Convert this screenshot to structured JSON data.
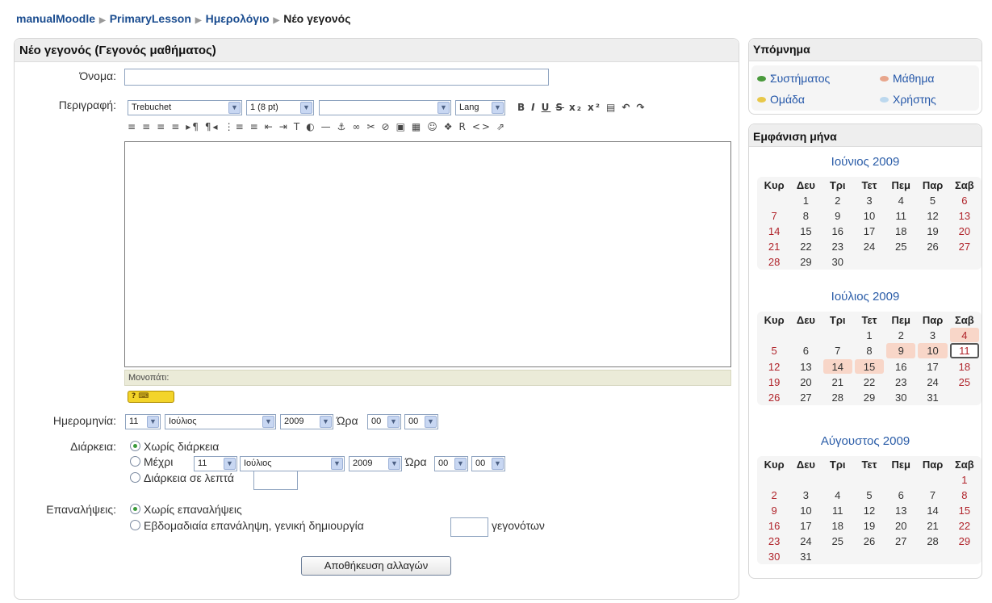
{
  "breadcrumb": [
    "manualMoodle",
    "PrimaryLesson",
    "Ημερολόγιο",
    "Νέο γεγονός"
  ],
  "form": {
    "title": "Νέο γεγονός (Γεγονός μαθήματος)",
    "name_label": "Όνομα:",
    "desc_label": "Περιγραφή:",
    "toolbar": {
      "font": "Trebuchet",
      "size": "1 (8 pt)",
      "format": "",
      "lang": "Lang",
      "row1_icons": [
        "B",
        "I",
        "U",
        "S",
        "x₂",
        "x²",
        "▤",
        "↶",
        "↷"
      ],
      "row2_icons": [
        "≡",
        "≡",
        "≡",
        "≡",
        "▸¶",
        "¶◂",
        "⋮≡",
        "≡",
        "⇤",
        "⇥",
        "T",
        "◐",
        "—",
        "⚓",
        "∞",
        "✂",
        "⊘",
        "▣",
        "▦",
        "☺",
        "❖",
        "R",
        "<>",
        "⇗"
      ]
    },
    "path_label": "Μονοπάτι:",
    "help_label": "? ⌨",
    "date_label": "Ημερομηνία:",
    "date": {
      "day": "11",
      "month": "Ιούλιος",
      "year": "2009",
      "time_label": "Ώρα",
      "hour": "00",
      "minute": "00"
    },
    "duration_label": "Διάρκεια:",
    "duration_options": {
      "none": "Χωρίς διάρκεια",
      "until": "Μέχρι",
      "minutes": "Διάρκεια σε λεπτά"
    },
    "until": {
      "day": "11",
      "month": "Ιούλιος",
      "year": "2009",
      "time_label": "Ώρα",
      "hour": "00",
      "minute": "00"
    },
    "repeat_label": "Επαναλήψεις:",
    "repeat_options": {
      "none": "Χωρίς επαναλήψεις",
      "weekly": "Εβδομαδιαία επανάληψη, γενική δημιουργία",
      "weekly_suffix": "γεγονότων"
    },
    "save_label": "Αποθήκευση αλλαγών"
  },
  "legend": {
    "title": "Υπόμνημα",
    "items": [
      {
        "label": "Συστήματος",
        "color": "#4a9a3c"
      },
      {
        "label": "Μάθημα",
        "color": "#e8a68c"
      },
      {
        "label": "Ομάδα",
        "color": "#e8c84a"
      },
      {
        "label": "Χρήστης",
        "color": "#bcd8ee"
      }
    ]
  },
  "calendar": {
    "title": "Εμφάνιση μήνα",
    "weekdays": [
      "Κυρ",
      "Δευ",
      "Τρι",
      "Τετ",
      "Πεμ",
      "Παρ",
      "Σαβ"
    ],
    "months": [
      {
        "name": "Ιούνιος 2009",
        "weeks": [
          [
            "",
            "1",
            "2",
            "3",
            "4",
            "5",
            "6"
          ],
          [
            "7",
            "8",
            "9",
            "10",
            "11",
            "12",
            "13"
          ],
          [
            "14",
            "15",
            "16",
            "17",
            "18",
            "19",
            "20"
          ],
          [
            "21",
            "22",
            "23",
            "24",
            "25",
            "26",
            "27"
          ],
          [
            "28",
            "29",
            "30",
            "",
            "",
            "",
            ""
          ]
        ],
        "event_days": [],
        "today": ""
      },
      {
        "name": "Ιούλιος 2009",
        "weeks": [
          [
            "",
            "",
            "",
            "1",
            "2",
            "3",
            "4"
          ],
          [
            "5",
            "6",
            "7",
            "8",
            "9",
            "10",
            "11"
          ],
          [
            "12",
            "13",
            "14",
            "15",
            "16",
            "17",
            "18"
          ],
          [
            "19",
            "20",
            "21",
            "22",
            "23",
            "24",
            "25"
          ],
          [
            "26",
            "27",
            "28",
            "29",
            "30",
            "31",
            ""
          ]
        ],
        "event_days": [
          "4",
          "9",
          "10",
          "14",
          "15"
        ],
        "today": "11"
      },
      {
        "name": "Αύγουστος 2009",
        "weeks": [
          [
            "",
            "",
            "",
            "",
            "",
            "",
            "1"
          ],
          [
            "2",
            "3",
            "4",
            "5",
            "6",
            "7",
            "8"
          ],
          [
            "9",
            "10",
            "11",
            "12",
            "13",
            "14",
            "15"
          ],
          [
            "16",
            "17",
            "18",
            "19",
            "20",
            "21",
            "22"
          ],
          [
            "23",
            "24",
            "25",
            "26",
            "27",
            "28",
            "29"
          ],
          [
            "30",
            "31",
            "",
            "",
            "",
            "",
            ""
          ]
        ],
        "event_days": [],
        "today": ""
      }
    ]
  }
}
